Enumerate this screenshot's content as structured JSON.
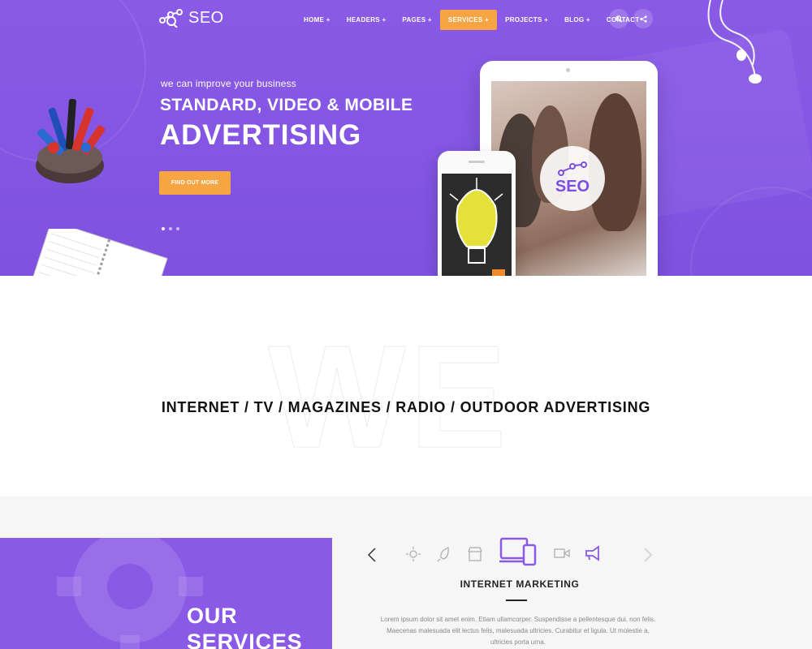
{
  "brand": {
    "logo_text": "SEO",
    "accent": "#8a5ae6",
    "highlight": "#f7a442"
  },
  "nav": {
    "items": [
      {
        "label": "HOME +",
        "active": false
      },
      {
        "label": "HEADERS +",
        "active": false
      },
      {
        "label": "PAGES +",
        "active": false
      },
      {
        "label": "SERVICES +",
        "active": true
      },
      {
        "label": "PROJECTS +",
        "active": false
      },
      {
        "label": "BLOG +",
        "active": false
      },
      {
        "label": "CONTACT",
        "active": false
      }
    ],
    "icons": [
      "search-icon",
      "share-icon"
    ]
  },
  "hero": {
    "subtitle": "we can improve your business",
    "title_line1": "STANDARD, VIDEO & MOBILE",
    "title_line2": "ADVERTISING",
    "cta_label": "FIND OUT MORE",
    "slides": 3,
    "active_slide": 1,
    "device_badge": "SEO"
  },
  "we_section": {
    "background_word": "WE",
    "strip": "INTERNET / TV / MAGAZINES / RADIO / OUTDOOR ADVERTISING"
  },
  "services": {
    "heading_line1": "OUR",
    "heading_line2": "SERVICES",
    "icons": [
      "chevron-left-icon",
      "sun-icon",
      "rocket-icon",
      "shop-icon",
      "devices-icon",
      "video-icon",
      "megaphone-icon",
      "chevron-right-icon"
    ],
    "active_icon": "devices-icon",
    "active_label": "INTERNET MARKETING",
    "description": "Lorem ipsum dolor sit amet enim. Etiam ullamcorper. Suspendisse a pellentesque dui, non felis. Maecenas malesuada elit lectus felis, malesuada ultricies. Curabitur et ligula. Ut molestie a, ultricies porta urna."
  }
}
